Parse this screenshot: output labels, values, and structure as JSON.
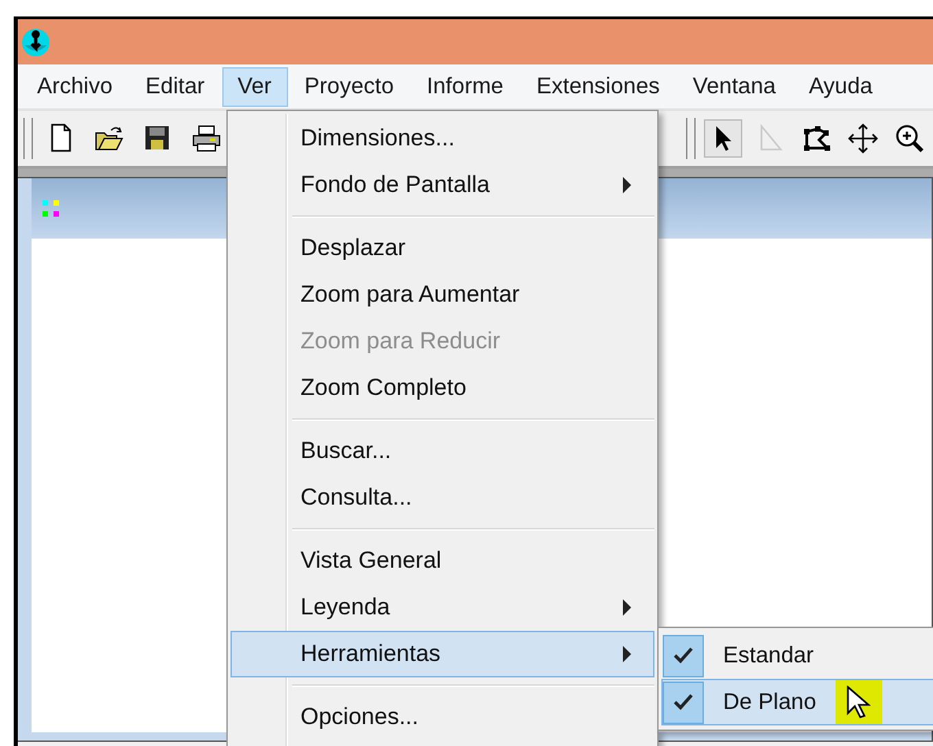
{
  "menubar": {
    "items": [
      {
        "label": "Archivo",
        "selected": false
      },
      {
        "label": "Editar",
        "selected": false
      },
      {
        "label": "Ver",
        "selected": true
      },
      {
        "label": "Proyecto",
        "selected": false
      },
      {
        "label": "Informe",
        "selected": false
      },
      {
        "label": "Extensiones",
        "selected": false
      },
      {
        "label": "Ventana",
        "selected": false
      },
      {
        "label": "Ayuda",
        "selected": false
      }
    ]
  },
  "toolbar": {
    "groups": [
      {
        "buttons": [
          {
            "kind": "new",
            "pressed": false,
            "disabled": false
          },
          {
            "kind": "open",
            "pressed": false,
            "disabled": false
          },
          {
            "kind": "save",
            "pressed": false,
            "disabled": false
          },
          {
            "kind": "print",
            "pressed": false,
            "disabled": false
          }
        ]
      },
      {
        "buttons": [
          {
            "kind": "pointer",
            "pressed": true,
            "disabled": false
          },
          {
            "kind": "vertex",
            "pressed": false,
            "disabled": true
          },
          {
            "kind": "polygon",
            "pressed": false,
            "disabled": false
          },
          {
            "kind": "move",
            "pressed": false,
            "disabled": false
          },
          {
            "kind": "zoom",
            "pressed": false,
            "disabled": false
          }
        ]
      }
    ]
  },
  "menu": {
    "items": [
      {
        "kind": "item",
        "label": "Dimensiones...",
        "disabled": false,
        "submenu": false,
        "selected": false
      },
      {
        "kind": "item",
        "label": "Fondo de Pantalla",
        "disabled": false,
        "submenu": true,
        "selected": false
      },
      {
        "kind": "separator"
      },
      {
        "kind": "item",
        "label": "Desplazar",
        "disabled": false,
        "submenu": false,
        "selected": false
      },
      {
        "kind": "item",
        "label": "Zoom para Aumentar",
        "disabled": false,
        "submenu": false,
        "selected": false
      },
      {
        "kind": "item",
        "label": "Zoom para Reducir",
        "disabled": true,
        "submenu": false,
        "selected": false
      },
      {
        "kind": "item",
        "label": "Zoom Completo",
        "disabled": false,
        "submenu": false,
        "selected": false
      },
      {
        "kind": "separator"
      },
      {
        "kind": "item",
        "label": "Buscar...",
        "disabled": false,
        "submenu": false,
        "selected": false
      },
      {
        "kind": "item",
        "label": "Consulta...",
        "disabled": false,
        "submenu": false,
        "selected": false
      },
      {
        "kind": "separator"
      },
      {
        "kind": "item",
        "label": "Vista General",
        "disabled": false,
        "submenu": false,
        "selected": false
      },
      {
        "kind": "item",
        "label": "Leyenda",
        "disabled": false,
        "submenu": true,
        "selected": false
      },
      {
        "kind": "item",
        "label": "Herramientas",
        "disabled": false,
        "submenu": true,
        "selected": true
      },
      {
        "kind": "separator"
      },
      {
        "kind": "item",
        "label": "Opciones...",
        "disabled": false,
        "submenu": false,
        "selected": false
      }
    ]
  },
  "submenu": {
    "items": [
      {
        "label": "Estandar",
        "checked": true,
        "selected": false
      },
      {
        "label": "De Plano",
        "checked": true,
        "selected": true
      }
    ]
  }
}
